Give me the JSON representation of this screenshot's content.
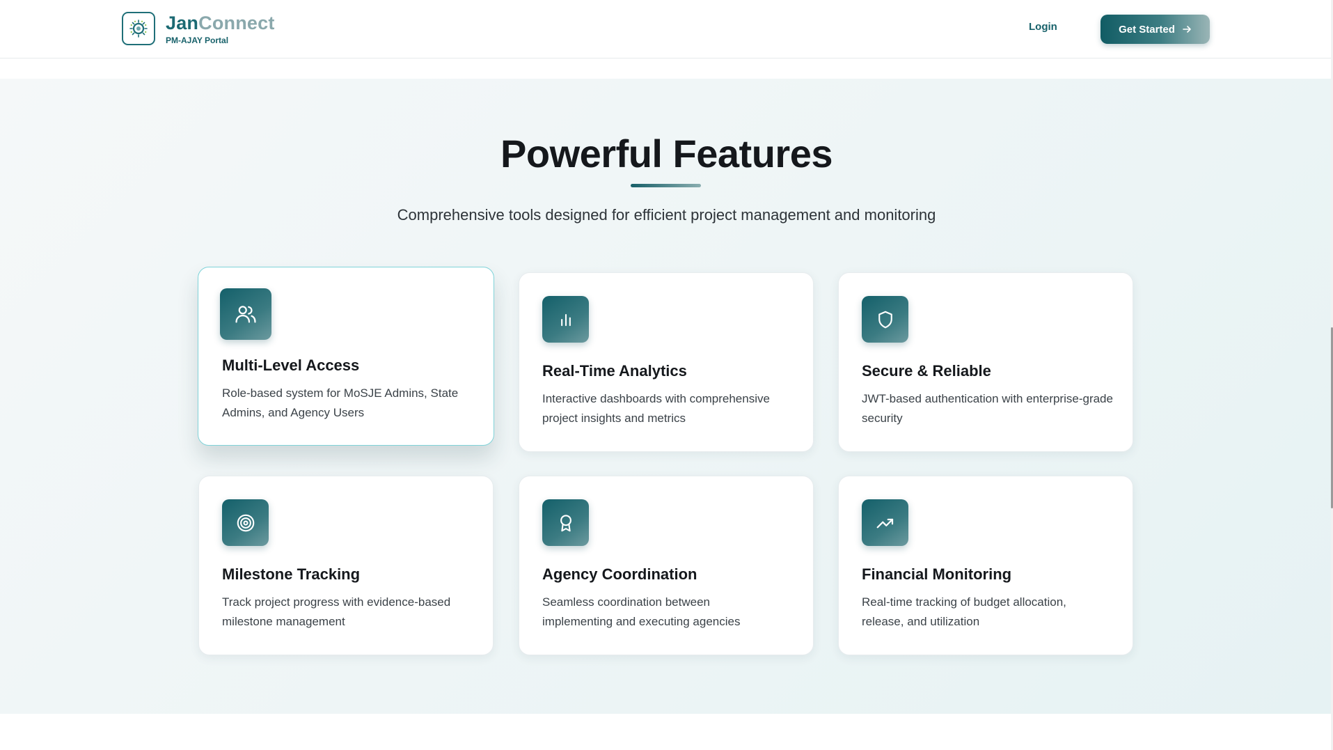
{
  "header": {
    "brand_name_part1": "Jan",
    "brand_name_part2": "Connect",
    "brand_sub": "PM-AJAY Portal",
    "login_label": "Login",
    "cta_label": "Get Started"
  },
  "features": {
    "title": "Powerful Features",
    "subtitle": "Comprehensive tools designed for efficient project management and monitoring",
    "cards": [
      {
        "title": "Multi-Level Access",
        "desc": "Role-based system for MoSJE Admins, State Admins, and Agency Users",
        "icon": "users-icon"
      },
      {
        "title": "Real-Time Analytics",
        "desc": "Interactive dashboards with comprehensive project insights and metrics",
        "icon": "bar-chart-icon"
      },
      {
        "title": "Secure & Reliable",
        "desc": "JWT-based authentication with enterprise-grade security",
        "icon": "shield-icon"
      },
      {
        "title": "Milestone Tracking",
        "desc": "Track project progress with evidence-based milestone management",
        "icon": "target-icon"
      },
      {
        "title": "Agency Coordination",
        "desc": "Seamless coordination between implementing and executing agencies",
        "icon": "award-icon"
      },
      {
        "title": "Financial Monitoring",
        "desc": "Real-time tracking of budget allocation, release, and utilization",
        "icon": "trending-up-icon"
      }
    ]
  },
  "colors": {
    "accent": "#1c6a73",
    "accent_light": "#8aa8ac",
    "card_highlight_border": "#7fd3d9"
  }
}
